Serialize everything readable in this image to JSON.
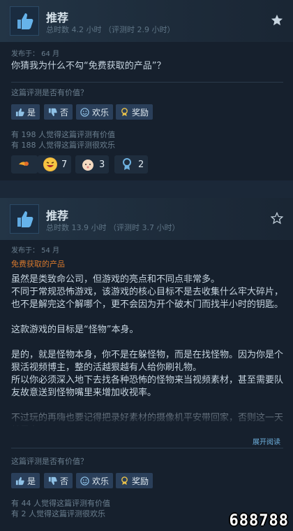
{
  "reviews": [
    {
      "recommendation": "推荐",
      "hours": "总时数 4.2 小时",
      "hours_at_review": "（评测时 2.9 小时）",
      "posted": "发布于： 64 月",
      "free_tag": "",
      "text": "你猜我为什么不勾“免费获取的产品”？",
      "question": "这篇评测是否有价值？",
      "buttons": {
        "yes": "是",
        "no": "否",
        "funny": "欢乐",
        "award": "奖励"
      },
      "helpful_line": "有 198 人觉得这篇评测有价值",
      "funny_line": "有 188 人觉得这篇评测很欢乐",
      "awards": [
        {
          "icon": "tongue-award-icon",
          "count": ""
        },
        {
          "icon": "laughing-award-icon",
          "count": "7"
        },
        {
          "icon": "baby-award-icon",
          "count": "3"
        },
        {
          "icon": "medal-award-icon",
          "count": "2"
        }
      ]
    },
    {
      "recommendation": "推荐",
      "hours": "总时数 13.9 小时",
      "hours_at_review": "（评测时 3.7 小时）",
      "posted": "发布于： 54 月",
      "free_tag": "免费获取的产品",
      "text": "虽然是类致命公司，但游戏的亮点和不同点非常多。\n不同于常规恐怖游戏，该游戏的核心目标不是去收集什么牢大碎片，也不是解完这个解哪个，更不会因为开个破木门而找半小时的钥匙。\n\n这款游戏的目标是“怪物”本身。\n\n是的，就是怪物本身，你不是在躲怪物，而是在找怪物。因为你是个狠活视频博主，整的活越狠越有人给你刷礼物。\n所以你必须深入地下去找各种恐怖的怪物来当视频素材，甚至需要队友故意送到怪物嘴里来增加收视率。\n\n不过玩的再嗨也要记得把录好素材的摄像机平安带回家，否则这一天就是白干。",
      "expand": "展开阅读",
      "question": "这篇评测是否有价值？",
      "buttons": {
        "yes": "是",
        "no": "否",
        "funny": "欢乐",
        "award": "奖励"
      },
      "helpful_line": "有 44 人觉得这篇评测有价值",
      "funny_line": "有 2 人觉得这篇评测很欢乐"
    }
  ],
  "watermark": "688788",
  "colors": {
    "background": "#1b2838",
    "card": "#16202d",
    "button": "#2a3f5a",
    "free_tag": "#d6782d",
    "link": "#6fb2e0"
  }
}
